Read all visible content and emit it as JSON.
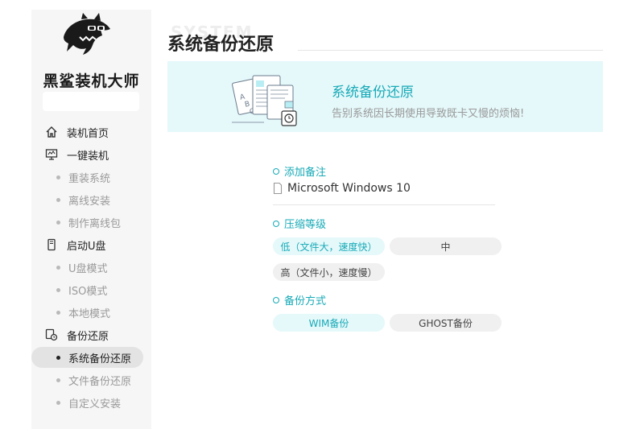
{
  "sidebar": {
    "brand": "黑鲨装机大师",
    "items": [
      {
        "label": "装机首页"
      },
      {
        "label": "一键装机"
      },
      {
        "label": "重装系统"
      },
      {
        "label": "离线安装"
      },
      {
        "label": "制作离线包"
      },
      {
        "label": "启动U盘"
      },
      {
        "label": "U盘模式"
      },
      {
        "label": "ISO模式"
      },
      {
        "label": "本地模式"
      },
      {
        "label": "备份还原"
      },
      {
        "label": "系统备份还原"
      },
      {
        "label": "文件备份还原"
      },
      {
        "label": "自定义安装"
      }
    ],
    "active_item": "系统备份还原"
  },
  "main": {
    "watermark": "SYSTEM",
    "title": "系统备份还原",
    "banner": {
      "title": "系统备份还原",
      "subtitle": "告别系统因长期使用导致既卡又慢的烦恼!"
    },
    "remark": {
      "heading": "添加备注",
      "value": "Microsoft Windows 10"
    },
    "compression": {
      "heading": "压缩等级",
      "options": [
        "低（文件大，速度快）",
        "中",
        "高（文件小，速度慢）"
      ],
      "selected": "低（文件大，速度快）"
    },
    "backup_method": {
      "heading": "备份方式",
      "options": [
        "WIM备份",
        "GHOST备份"
      ],
      "selected": "WIM备份"
    }
  },
  "colors": {
    "accent": "#17aab7",
    "banner_bg": "#e5f8fa",
    "sidebar_bg": "#f6f6f6"
  }
}
